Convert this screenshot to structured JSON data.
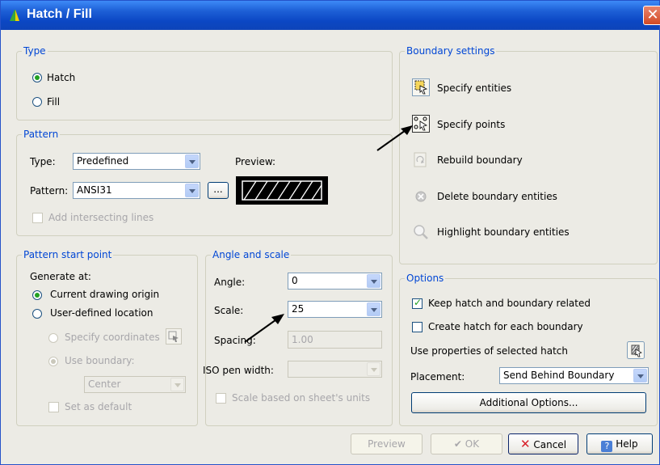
{
  "title": "Hatch / Fill",
  "type_group": {
    "label": "Type",
    "hatch_label": "Hatch",
    "fill_label": "Fill"
  },
  "pattern_group": {
    "label": "Pattern",
    "type_label": "Type:",
    "type_value": "Predefined",
    "preview_label": "Preview:",
    "pattern_label": "Pattern:",
    "pattern_value": "ANSI31",
    "browse_label": "...",
    "intersect_label": "Add intersecting lines"
  },
  "start_group": {
    "label": "Pattern start point",
    "generate_label": "Generate at:",
    "current_label": "Current drawing origin",
    "user_label": "User-defined location",
    "coords_label": "Specify coordinates",
    "boundary_label": "Use boundary:",
    "boundary_value": "Center",
    "default_label": "Set as default"
  },
  "angle_group": {
    "label": "Angle and scale",
    "angle_label": "Angle:",
    "angle_value": "0",
    "scale_label": "Scale:",
    "scale_value": "25",
    "spacing_label": "Spacing:",
    "spacing_value": "1.00",
    "iso_label": "ISO pen width:",
    "sheet_label": "Scale based on sheet's units"
  },
  "boundary_group": {
    "label": "Boundary settings",
    "items": [
      {
        "label": "Specify entities",
        "icon": "select-entities-icon"
      },
      {
        "label": "Specify points",
        "icon": "pick-points-icon"
      },
      {
        "label": "Rebuild boundary",
        "icon": "rebuild-icon"
      },
      {
        "label": "Delete boundary entities",
        "icon": "delete-boundary-icon"
      },
      {
        "label": "Highlight boundary entities",
        "icon": "magnifier-icon"
      }
    ]
  },
  "options_group": {
    "label": "Options",
    "keep_label": "Keep hatch and boundary related",
    "create_label": "Create hatch for each boundary",
    "use_props_label": "Use properties of selected hatch",
    "placement_label": "Placement:",
    "placement_value": "Send Behind Boundary",
    "additional_label": "Additional Options..."
  },
  "footer": {
    "preview_label": "Preview",
    "ok_label": "OK",
    "cancel_label": "Cancel",
    "help_label": "Help"
  },
  "colors": {
    "titlebar": "#0b47c4",
    "group_label": "#0046d5",
    "annotation_arrow": "#000000"
  }
}
